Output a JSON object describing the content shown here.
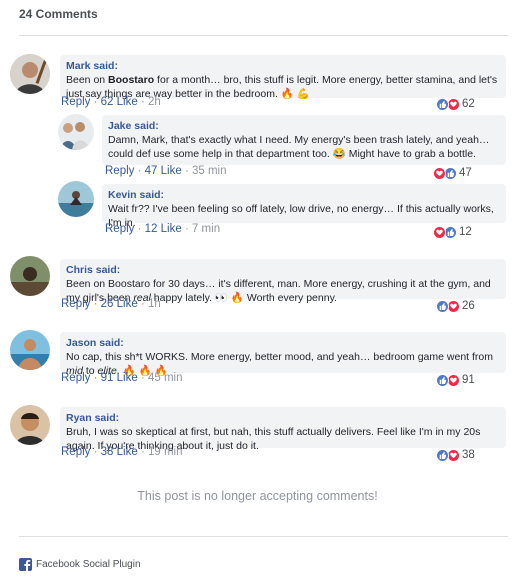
{
  "header": {
    "count_label": "24 Comments"
  },
  "comments": [
    {
      "author": "Mark said:",
      "text_parts": [
        "Been on ",
        "Boostaro",
        " for a month… bro, this stuff is legit. More energy, better stamina, and let's just say things are way better in the bedroom. 🔥 💪"
      ],
      "reply": "Reply",
      "likes": "62 Like",
      "time": "2h",
      "reactions": [
        "like",
        "love"
      ],
      "reaction_count": "62"
    },
    {
      "author": "Jake said:",
      "text": "Damn, Mark, that's exactly what I need. My energy's been trash lately, and yeah… could def use some help in that department too. 😂 Might have to grab a bottle.",
      "reply": "Reply",
      "likes": "47 Like",
      "time": "35 min",
      "reactions": [
        "love",
        "like"
      ],
      "reaction_count": "47"
    },
    {
      "author": "Kevin said:",
      "text": "Wait fr?? I've been feeling so off lately, low drive, no energy… If this actually works, I'm in.",
      "reply": "Reply",
      "likes": "12 Like",
      "time": "7 min",
      "reactions": [
        "love",
        "like"
      ],
      "reaction_count": "12"
    },
    {
      "author": "Chris said:",
      "text_parts": [
        "Been on Boostaro for 30 days… it's different, man. More energy, crushing it at the gym, and my girl's been ",
        "real",
        " happy lately. 👀 🔥 Worth every penny."
      ],
      "reply": "Reply",
      "likes": "26 Like",
      "time": "1h",
      "reactions": [
        "like",
        "love"
      ],
      "reaction_count": "26"
    },
    {
      "author": "Jason said:",
      "text_parts": [
        "No cap, this sh*t WORKS. More energy, better mood, and yeah… bedroom game went from ",
        "mid",
        " to ",
        "elite",
        ". 🔥 🔥 🔥"
      ],
      "reply": "Reply",
      "likes": "91 Like",
      "time": "45 min",
      "reactions": [
        "like",
        "love"
      ],
      "reaction_count": "91"
    },
    {
      "author": "Ryan said:",
      "text": "Bruh, I was so skeptical at first, but nah, this stuff actually delivers. Feel like I'm in my 20s again. If you're thinking about it, just do it.",
      "reply": "Reply",
      "likes": "38 Like",
      "time": "19 min",
      "reactions": [
        "like",
        "love"
      ],
      "reaction_count": "38"
    }
  ],
  "footer": {
    "closed_notice": "This post is no longer accepting comments!",
    "plugin_label": "Facebook Social Plugin"
  },
  "colors": {
    "link": "#365899",
    "like": "#4f79c5",
    "love": "#f0284a",
    "bubble": "#f2f3f5"
  }
}
